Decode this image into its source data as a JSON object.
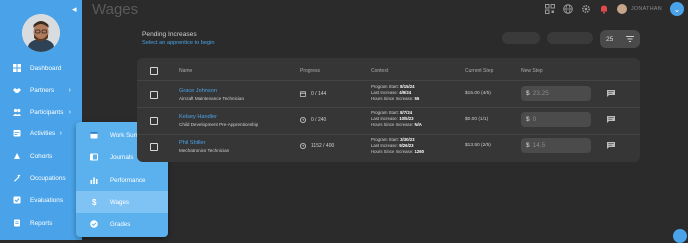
{
  "page": {
    "title": "Wages"
  },
  "user": {
    "name": "JONATHAN"
  },
  "sidebar": {
    "items": [
      {
        "label": "Dashboard",
        "icon": "dashboard-icon",
        "chevron": false
      },
      {
        "label": "Partners",
        "icon": "handshake-icon",
        "chevron": true
      },
      {
        "label": "Participants",
        "icon": "people-icon",
        "chevron": true
      },
      {
        "label": "Activities",
        "icon": "activities-icon",
        "chevron": true
      },
      {
        "label": "Cohorts",
        "icon": "cohorts-icon",
        "chevron": false
      },
      {
        "label": "Occupations",
        "icon": "wrench-icon",
        "chevron": false
      },
      {
        "label": "Evaluations",
        "icon": "evaluations-icon",
        "chevron": false
      },
      {
        "label": "Reports",
        "icon": "reports-icon",
        "chevron": false
      }
    ]
  },
  "activities_menu": {
    "items": [
      {
        "label": "Work Summary",
        "icon": "calendar-icon"
      },
      {
        "label": "Journals",
        "icon": "journal-icon"
      },
      {
        "label": "Performance",
        "icon": "bar-chart-icon"
      },
      {
        "label": "Wages",
        "icon": "dollar-icon",
        "active": true
      },
      {
        "label": "Grades",
        "icon": "check-circle-icon"
      }
    ]
  },
  "pending": {
    "title": "Pending Increases",
    "subtitle": "Select an apprentice to begin"
  },
  "per_page": "25",
  "table": {
    "columns": [
      "Name",
      "Progress",
      "Context",
      "Current Step",
      "New Step"
    ],
    "rows": [
      {
        "name": "Grace Johnson",
        "role": "Aircraft Maintenance Technician",
        "progress": "0 / 144",
        "progress_icon": "hours-icon",
        "ctx": [
          {
            "label": "Program Start:",
            "value": "8/15/24"
          },
          {
            "label": "Last Increase:",
            "value": "4/9/24"
          },
          {
            "label": "Hours Since Increase:",
            "value": "55"
          }
        ],
        "current_step": "$15.00 (4/5)",
        "new_step_placeholder": "23.25"
      },
      {
        "name": "Kelsey Handler",
        "role": "Child Development Pre-Apprenticeship",
        "progress": "0 / 240",
        "progress_icon": "clock-icon",
        "ctx": [
          {
            "label": "Program Start:",
            "value": "8/7/24"
          },
          {
            "label": "Last Increase:",
            "value": "10/5/23"
          },
          {
            "label": "Hours Since Increase:",
            "value": "N/A"
          }
        ],
        "current_step": "$0.00 (1/1)",
        "new_step_placeholder": "0"
      },
      {
        "name": "Phil Shiller",
        "role": "Mechatronics Technician",
        "progress": "1152 / 400",
        "progress_icon": "clock-icon",
        "ctx": [
          {
            "label": "Program Start:",
            "value": "3/30/23"
          },
          {
            "label": "Last Increase:",
            "value": "9/26/23"
          },
          {
            "label": "Hours Since Increase:",
            "value": "1260"
          }
        ],
        "current_step": "$13.50 (2/5)",
        "new_step_placeholder": "14.5"
      }
    ]
  },
  "colors": {
    "accent": "#4aa3e8",
    "background": "#2b2b2b",
    "panel": "#363636"
  }
}
